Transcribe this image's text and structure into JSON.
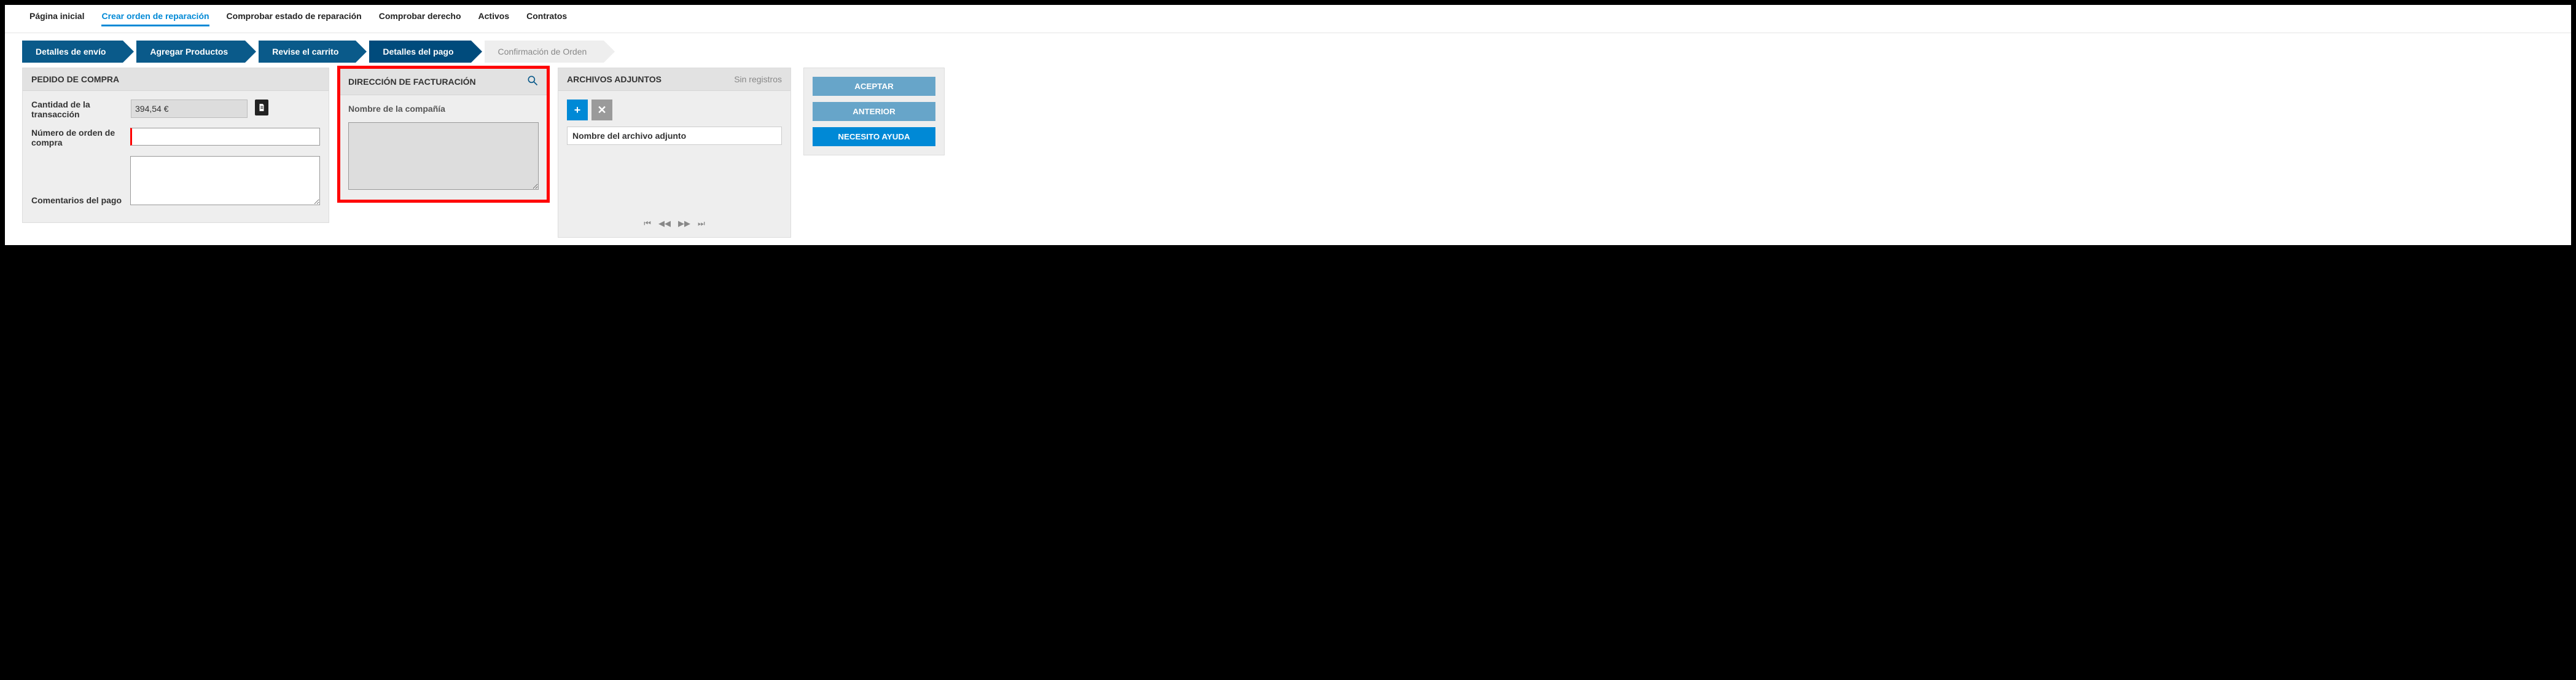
{
  "nav": {
    "items": [
      {
        "label": "Página inicial"
      },
      {
        "label": "Crear orden de reparación"
      },
      {
        "label": "Comprobar estado de reparación"
      },
      {
        "label": "Comprobar derecho"
      },
      {
        "label": "Activos"
      },
      {
        "label": "Contratos"
      }
    ],
    "active_index": 1
  },
  "stepper": {
    "steps": [
      {
        "label": "Detalles de envío"
      },
      {
        "label": "Agregar Productos"
      },
      {
        "label": "Revise el carrito"
      },
      {
        "label": "Detalles del pago"
      },
      {
        "label": "Confirmación de Orden"
      }
    ],
    "current_index": 3
  },
  "po": {
    "title": "PEDIDO DE COMPRA",
    "amount_label": "Cantidad de la transacción",
    "amount_value": "394,54 €",
    "number_label": "Número de orden de compra",
    "number_value": "",
    "comments_label": "Comentarios del pago",
    "comments_value": ""
  },
  "billing": {
    "title": "DIRECCIÓN DE FACTURACIÓN",
    "company_label": "Nombre de la compañía",
    "company_value": ""
  },
  "attachments": {
    "title": "ARCHIVOS ADJUNTOS",
    "status": "Sin registros",
    "col_name": "Nombre del archivo adjunto"
  },
  "actions": {
    "accept": "ACEPTAR",
    "previous": "ANTERIOR",
    "help": "NECESITO AYUDA"
  },
  "icons": {
    "plus": "+",
    "close": "✕",
    "first": "⏮",
    "prev": "◀◀",
    "next": "▶▶",
    "last": "⏭"
  }
}
